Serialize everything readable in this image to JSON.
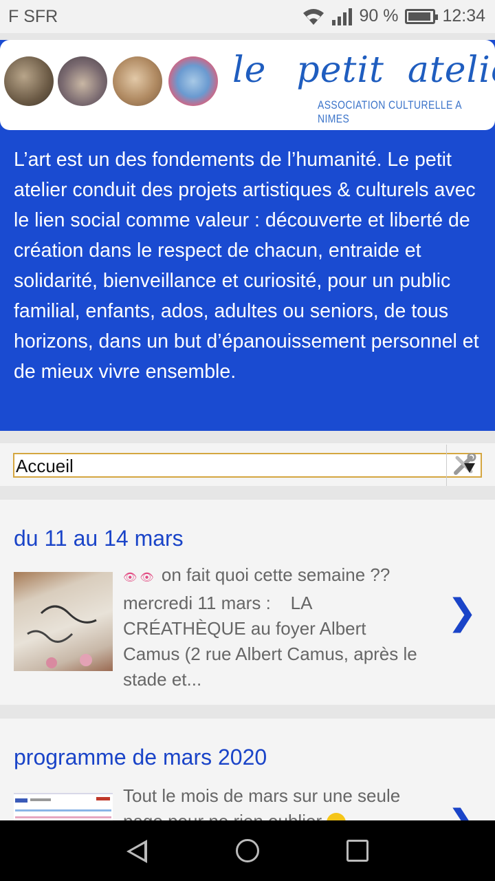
{
  "status": {
    "carrier": "F SFR",
    "battery": "90 %",
    "time": "12:34"
  },
  "header": {
    "brand_words": [
      "le",
      "petit",
      "atelier"
    ],
    "tagline": "ASSOCIATION CULTURELLE A NIMES",
    "intro": "L’art est un des fondements de l’humanité. Le petit atelier conduit des projets artistiques & culturels avec le lien social comme valeur : découverte et liberté de création dans le respect de chacun, entraide et solidarité, bienveillance et curiosité, pour un public familial, enfants, ados, adultes ou seniors, de tous horizons, dans un but d’épanouissement personnel et de mieux vivre ensemble."
  },
  "nav_select": {
    "selected": "Accueil"
  },
  "posts": [
    {
      "title": "du 11 au 14 mars",
      "excerpt_lines": [
        "on fait quoi cette semaine ??",
        "mercredi 11 mars :    LA",
        "CRÉATHÈQUE au foyer Albert",
        "Camus (2 rue Albert Camus, après le",
        "stade et..."
      ],
      "chevron": "❯"
    },
    {
      "title": "programme de mars 2020",
      "excerpt_lines": [
        "Tout le mois de mars sur une seule",
        "page pour ne rien oublier"
      ],
      "chevron": "❯"
    }
  ],
  "colors": {
    "banner_blue": "#1a4bd1",
    "link_blue": "#1a44c8",
    "select_border": "#d4a640"
  }
}
